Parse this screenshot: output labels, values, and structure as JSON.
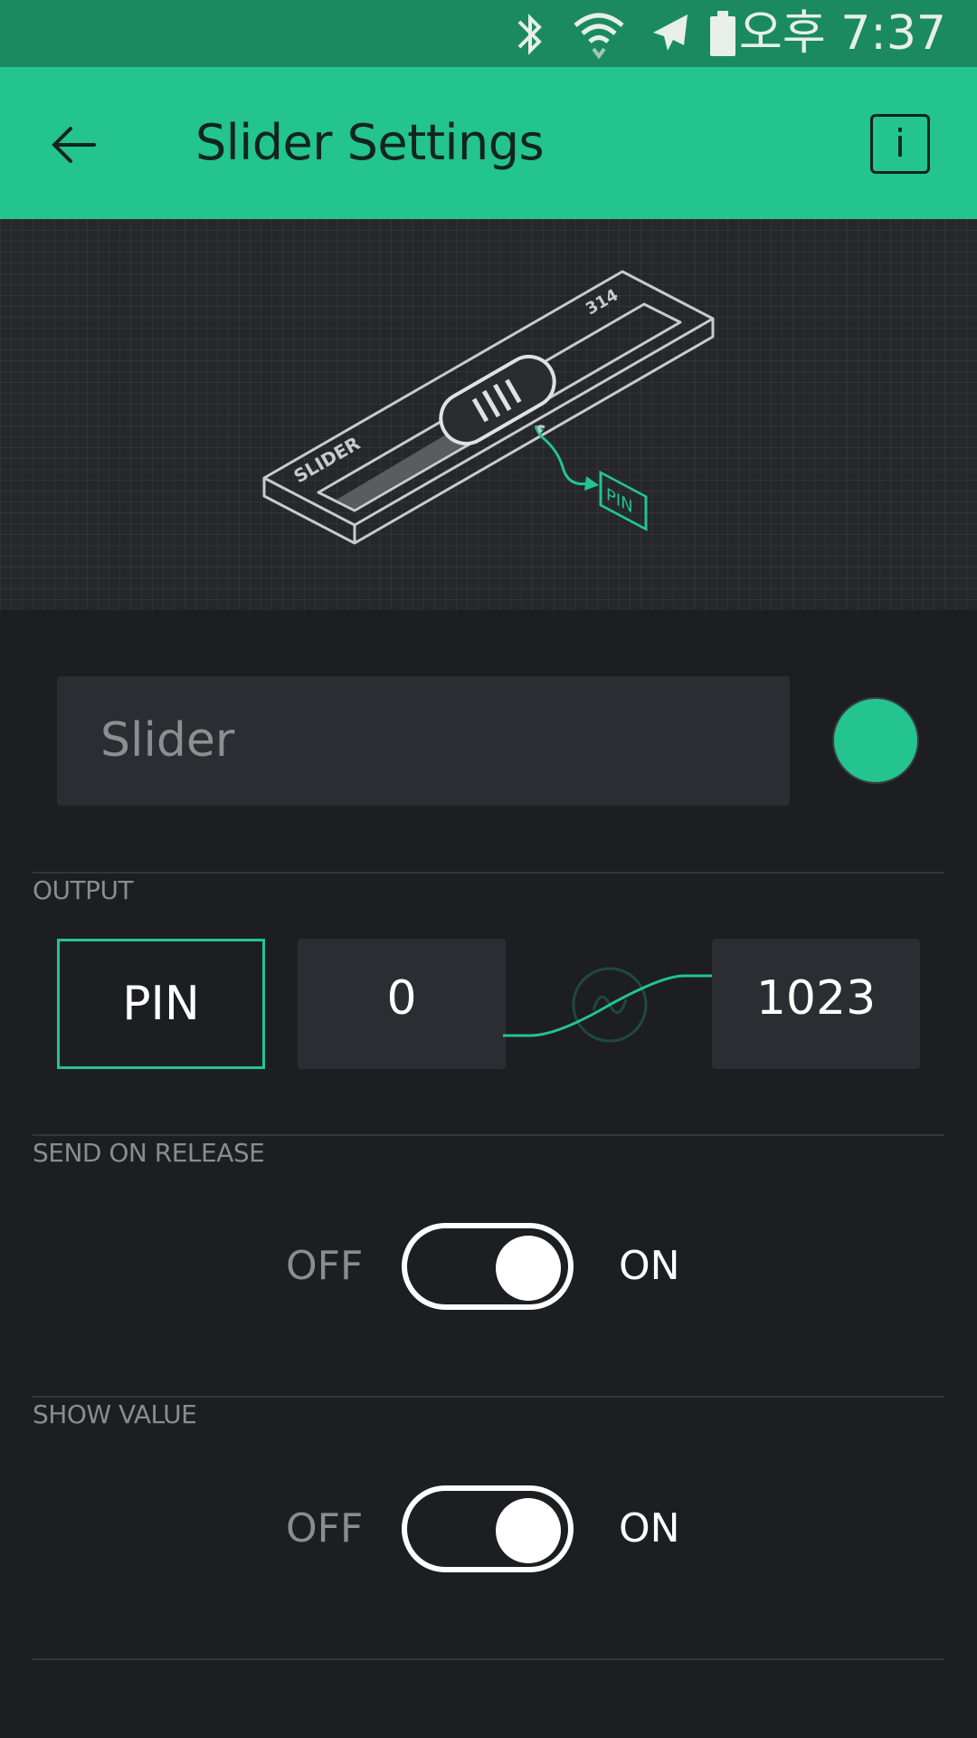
{
  "status_bar": {
    "time": "오후 7:37",
    "icons": [
      "bluetooth-icon",
      "wifi-icon",
      "airplane-icon",
      "battery-icon"
    ]
  },
  "app_bar": {
    "title": "Slider Settings",
    "info_label": "i",
    "back_icon": "arrow-left-icon"
  },
  "illustration": {
    "body_label": "SLIDER",
    "value_label": "314",
    "pin_label": "PIN"
  },
  "name_input": {
    "placeholder": "Slider",
    "value": ""
  },
  "widget_color": "#23c48e",
  "output": {
    "section_label": "OUTPUT",
    "pin_label": "PIN",
    "min_value": "0",
    "max_value": "1023"
  },
  "send_on_release": {
    "section_label": "SEND ON RELEASE",
    "off_label": "OFF",
    "on_label": "ON",
    "state": "on"
  },
  "show_value": {
    "section_label": "SHOW VALUE",
    "off_label": "OFF",
    "on_label": "ON",
    "state": "on"
  },
  "colors": {
    "accent": "#23c48e",
    "status_bar": "#1b8a63",
    "background": "#1d1e22",
    "field": "#2c2d32"
  }
}
